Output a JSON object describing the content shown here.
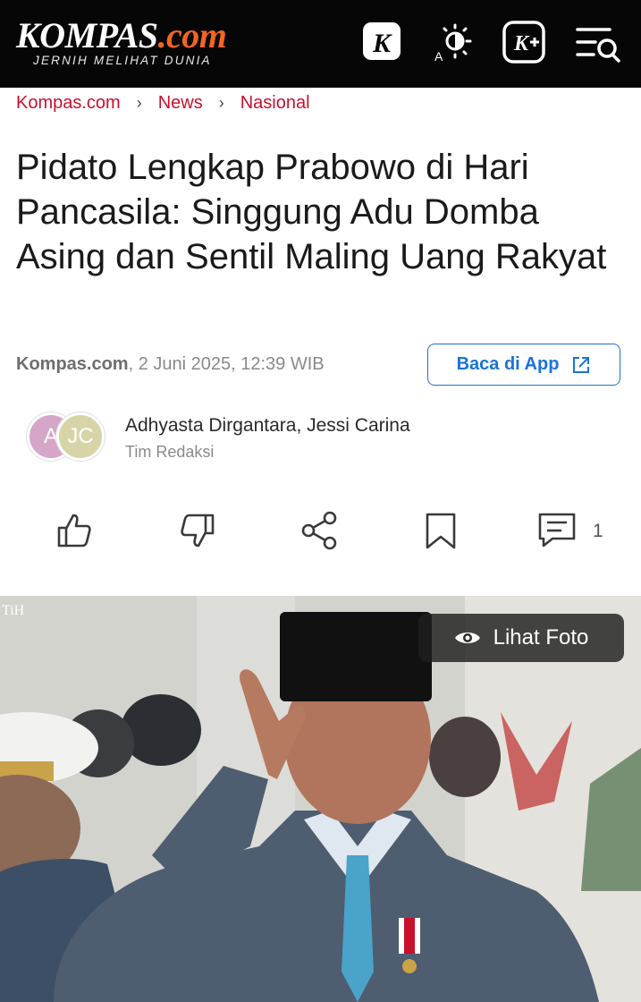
{
  "header": {
    "logo_main": "KOMPAS",
    "logo_dotcom": ".com",
    "logo_tagline": "JERNIH MELIHAT DUNIA",
    "icons": [
      "k-icon",
      "theme-toggle-icon",
      "kplus-icon",
      "menu-search-icon"
    ]
  },
  "breadcrumb": {
    "items": [
      "Kompas.com",
      "News",
      "Nasional"
    ],
    "separator": "›"
  },
  "article": {
    "title": "Pidato Lengkap Prabowo di Hari Pancasila: Singgung Adu Domba Asing dan Sentil Maling Uang Rakyat",
    "source": "Kompas.com",
    "datetime": ", 2 Juni 2025, 12:39 WIB",
    "app_button": "Baca di App",
    "authors_initials": [
      "A",
      "JC"
    ],
    "authors": "Adhyasta Dirgantara,  Jessi Carina",
    "team": "Tim Redaksi"
  },
  "actions": {
    "icons": [
      "like-icon",
      "dislike-icon",
      "share-icon",
      "bookmark-icon",
      "comment-icon"
    ],
    "comment_count": "1"
  },
  "photo": {
    "watermark": "TiH",
    "view_button": "Lihat Foto"
  },
  "colors": {
    "header_bg": "#060606",
    "brand_orange": "#f26522",
    "breadcrumb_red": "#c8102e",
    "app_blue": "#1a73d8",
    "avatar_a": "#d6a6c8",
    "avatar_jc": "#d7d4a8"
  }
}
